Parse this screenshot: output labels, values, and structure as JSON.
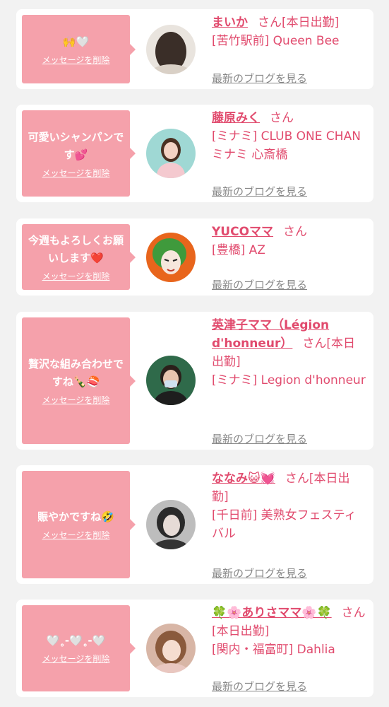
{
  "delete_label": "メッセージを削除",
  "blog_label": "最新のブログを見る",
  "colors": {
    "bubble": "#f5a1ab",
    "accent": "#e14b6e",
    "muted": "#888888",
    "background": "#f2f2f2"
  },
  "cards": [
    {
      "message": "🙌🤍",
      "name": "まいか",
      "suffix": "さん[本日出勤]",
      "shop": "[苦竹駅前] Queen Bee"
    },
    {
      "message": "可愛いシャンパンです💕",
      "name": "藤原みく",
      "suffix": "さん",
      "shop": "[ミナミ] CLUB ONE CHAN ミナミ 心斎橋"
    },
    {
      "message": "今週もよろしくお願いします❤️",
      "name": "YUCOママ",
      "suffix": "さん",
      "shop": "[豊橋] AZ"
    },
    {
      "message": "贅沢な組み合わせですね🍾🍣",
      "name": "英津子ママ（Légion d'honneur）",
      "suffix": "さん[本日出勤]",
      "shop": "[ミナミ] Legion d'honneur"
    },
    {
      "message": "賑やかですね🤣",
      "name": "ななみ😺💓",
      "suffix": "さん[本日出勤]",
      "shop": "[千日前] 美熟女フェスティバル"
    },
    {
      "message": "🤍˳-🤍˳-🤍",
      "name": "🍀🌸ありさママ🌸🍀",
      "suffix": "さん[本日出勤]",
      "shop": "[関内・福富町] Dahlia"
    }
  ]
}
